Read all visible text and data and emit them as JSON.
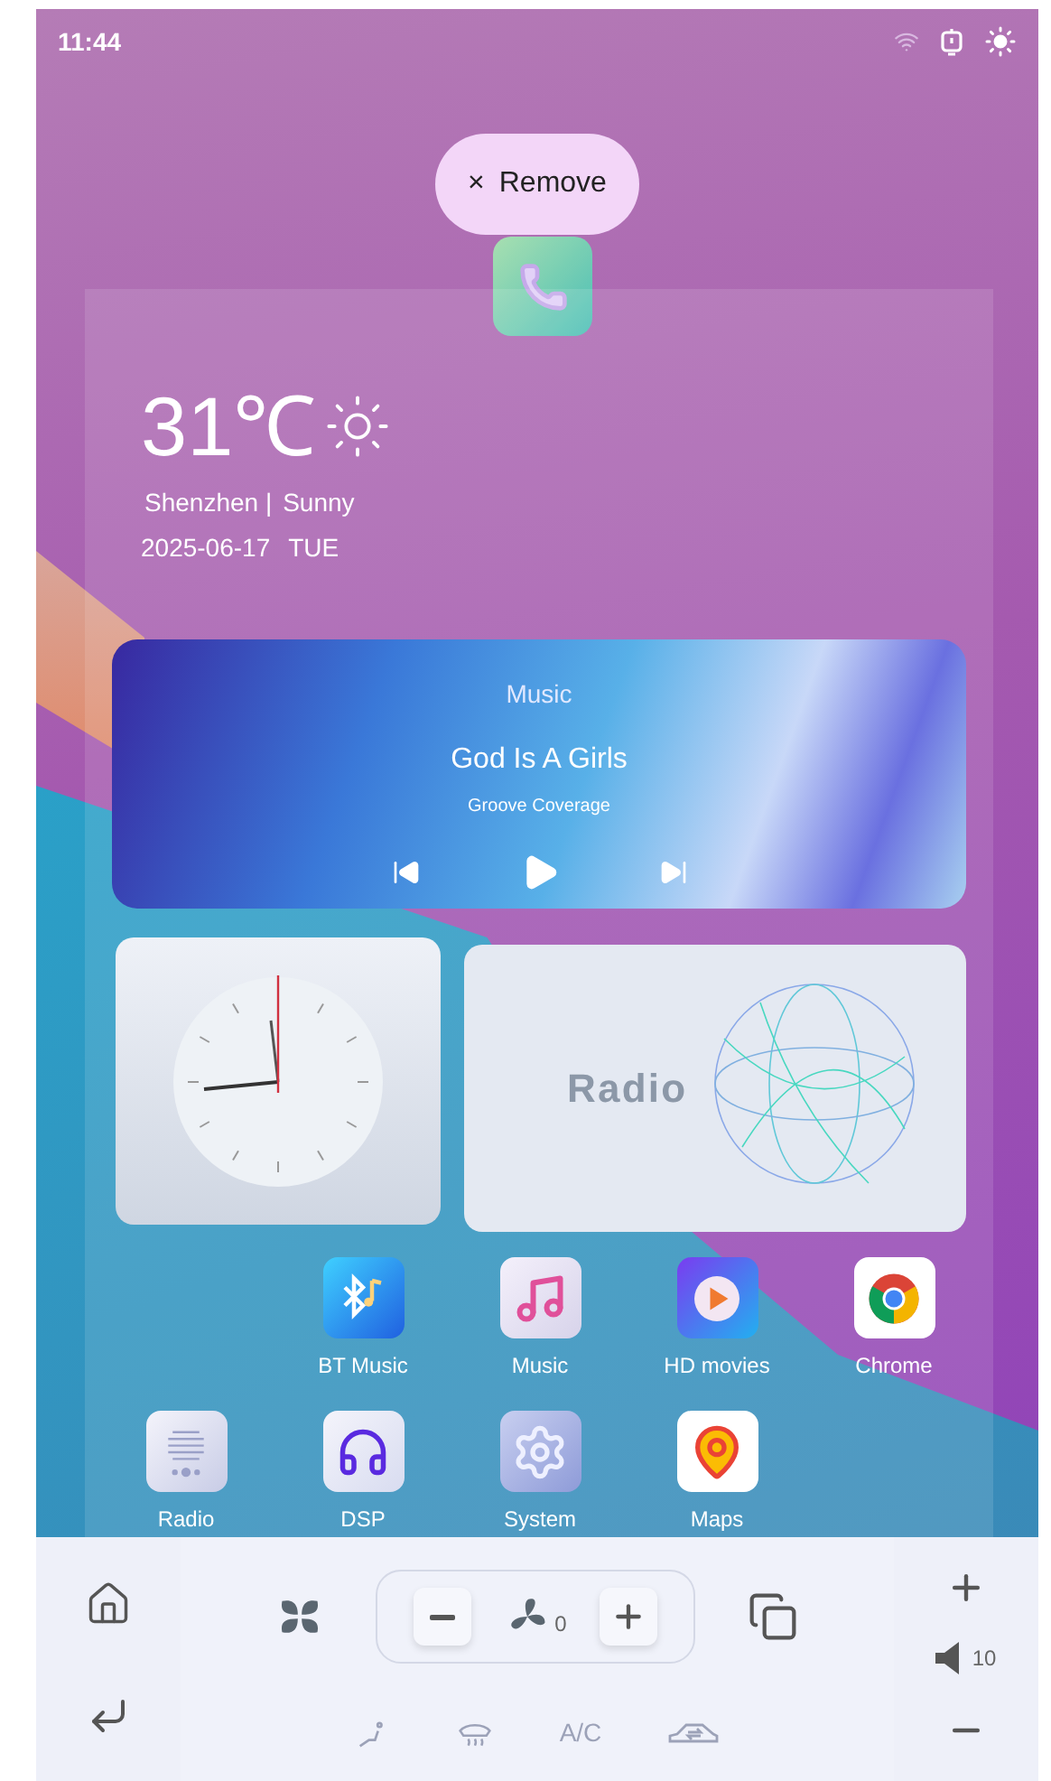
{
  "status_bar": {
    "time": "11:44"
  },
  "drag_target": {
    "close": "×",
    "label": "Remove"
  },
  "weather": {
    "temperature": "31℃",
    "city": "Shenzhen |",
    "condition": "Sunny",
    "date": "2025-06-17",
    "weekday": "TUE"
  },
  "music_widget": {
    "title": "Music",
    "song": "God Is A Girls",
    "artist": "Groove Coverage"
  },
  "radio_widget": {
    "label": "Radio"
  },
  "apps": [
    {
      "kind": "bt",
      "label": "BT Music"
    },
    {
      "kind": "music",
      "label": "Music"
    },
    {
      "kind": "movies",
      "label": "HD movies"
    },
    {
      "kind": "chrome",
      "label": "Chrome"
    },
    {
      "kind": "radio",
      "label": "Radio"
    },
    {
      "kind": "dsp",
      "label": "DSP"
    },
    {
      "kind": "system",
      "label": "System"
    },
    {
      "kind": "maps",
      "label": "Maps"
    }
  ],
  "climate": {
    "fan_speed": "0",
    "toggles": [
      {
        "kind": "seat",
        "on": false
      },
      {
        "kind": "defrost",
        "on": false
      },
      {
        "kind": "ac",
        "label": "A/C",
        "on": false
      },
      {
        "kind": "recirculation",
        "on": false
      }
    ]
  },
  "volume": {
    "value": "10"
  }
}
